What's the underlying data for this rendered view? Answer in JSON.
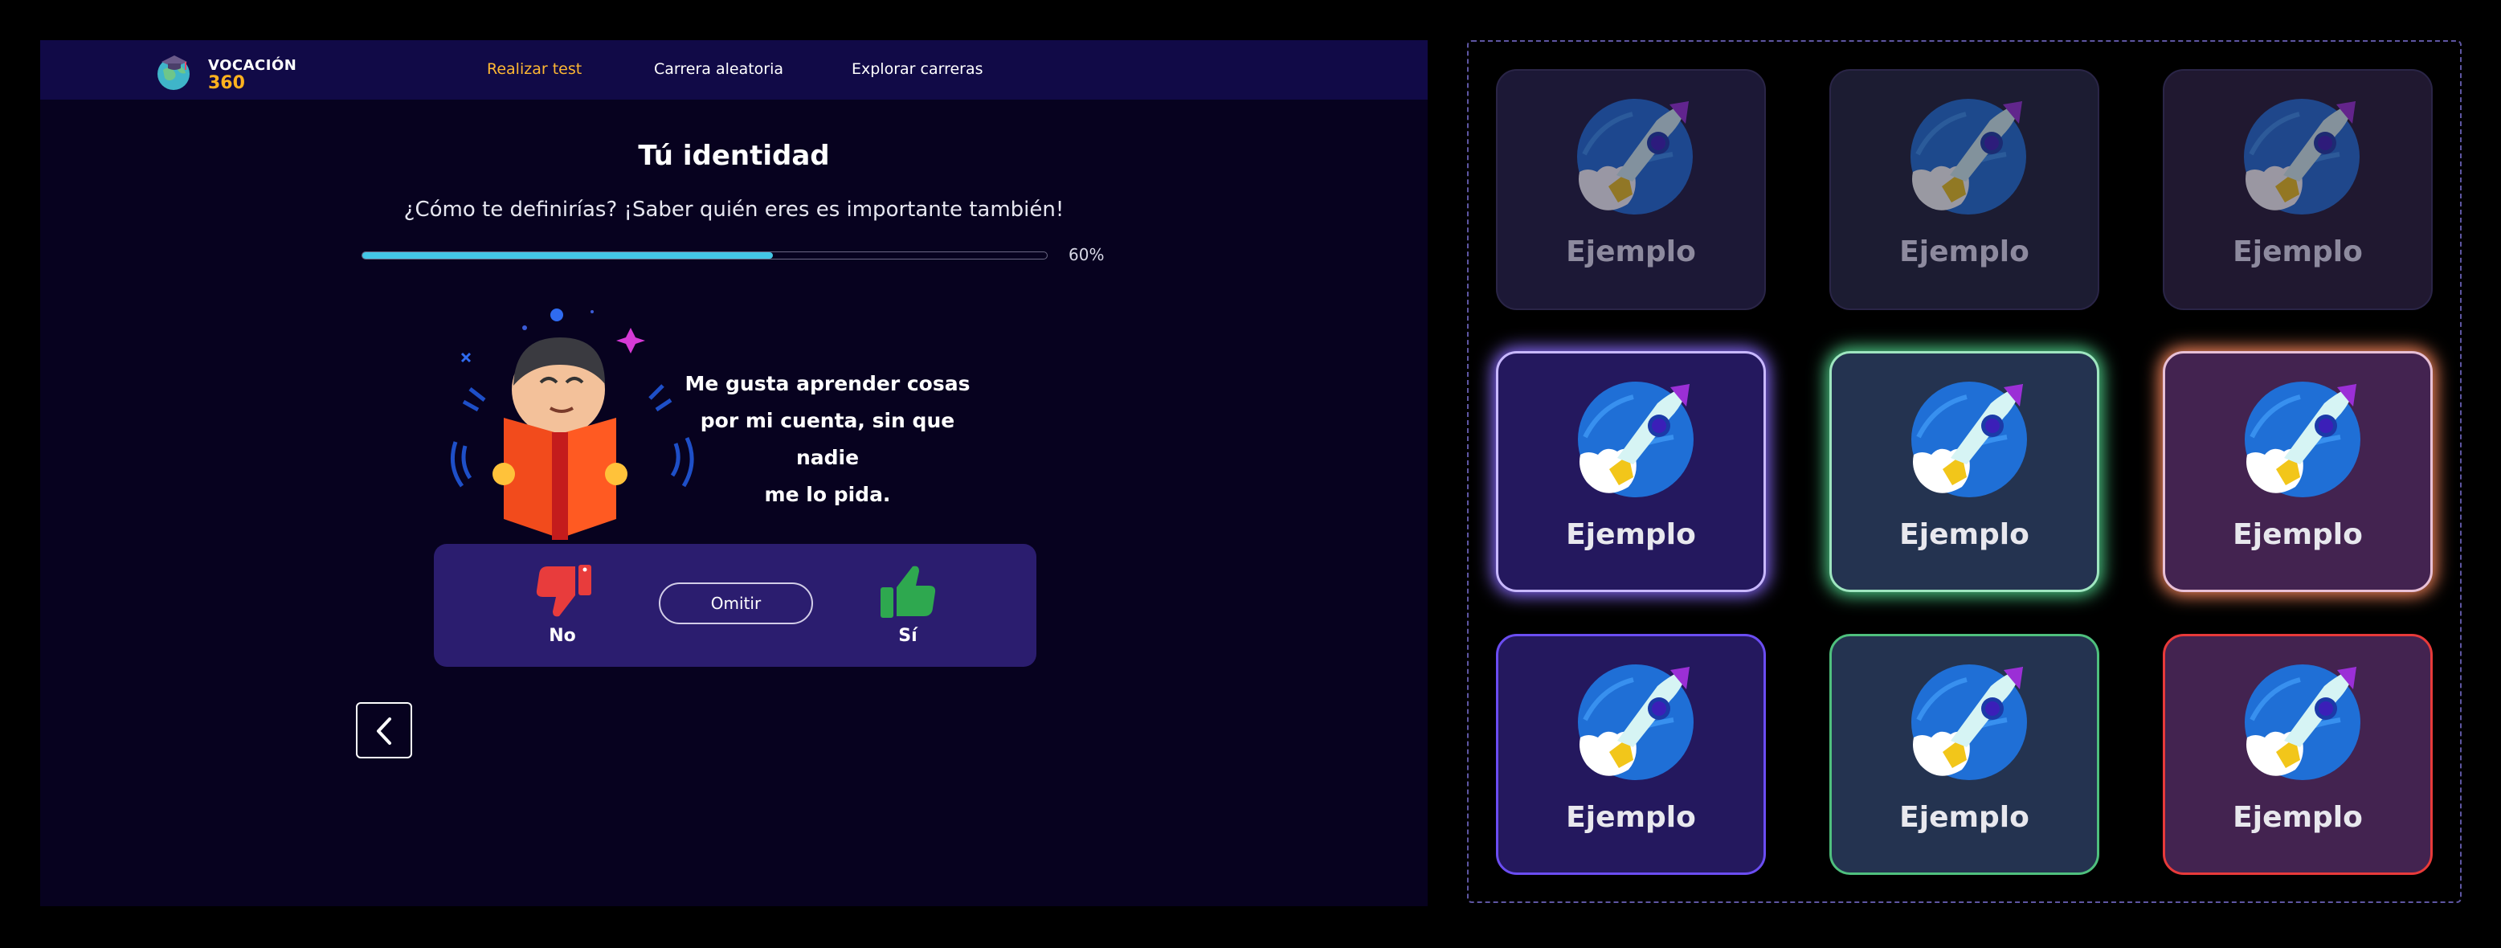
{
  "logo": {
    "line1": "VOCACIÓN",
    "line2": "360"
  },
  "nav": {
    "items": [
      {
        "label": "Realizar test",
        "active": true
      },
      {
        "label": "Carrera aleatoria",
        "active": false
      },
      {
        "label": "Explorar carreras",
        "active": false
      }
    ]
  },
  "page": {
    "title": "Tú identidad",
    "subtitle": "¿Cómo te definirías? ¡Saber quién eres es importante también!",
    "progress_percent": 60,
    "progress_label": "60%",
    "question_lines": [
      "Me gusta aprender cosas",
      "por mi cuenta, sin que nadie",
      "me lo pida."
    ]
  },
  "answers": {
    "no_label": "No",
    "skip_label": "Omitir",
    "yes_label": "Sí"
  },
  "cards": [
    {
      "label": "Ejemplo",
      "style": "faded",
      "tint": "#1c1836"
    },
    {
      "label": "Ejemplo",
      "style": "faded",
      "tint": "#1c1c32"
    },
    {
      "label": "Ejemplo",
      "style": "faded",
      "tint": "#201830"
    },
    {
      "label": "Ejemplo",
      "style": "glow",
      "bg": "#24185e",
      "border": "#c8b8ff",
      "glow": "#8a6cff"
    },
    {
      "label": "Ejemplo",
      "style": "glow",
      "bg": "#243350",
      "border": "#9fe6c0",
      "glow": "#4fd08a"
    },
    {
      "label": "Ejemplo",
      "style": "glow",
      "bg": "#432350",
      "border": "#e8c0d6",
      "glow": "#ff8a5e"
    },
    {
      "label": "Ejemplo",
      "style": "outline",
      "bg": "#24185e",
      "border": "#6b4df2"
    },
    {
      "label": "Ejemplo",
      "style": "outline",
      "bg": "#243350",
      "border": "#4fc07e"
    },
    {
      "label": "Ejemplo",
      "style": "outline",
      "bg": "#432350",
      "border": "#e83a3a"
    }
  ],
  "colors": {
    "accent": "#ffb833",
    "progress": "#43c7e6",
    "thumbs_down": "#e83c3c",
    "thumbs_up": "#2ea84f"
  }
}
